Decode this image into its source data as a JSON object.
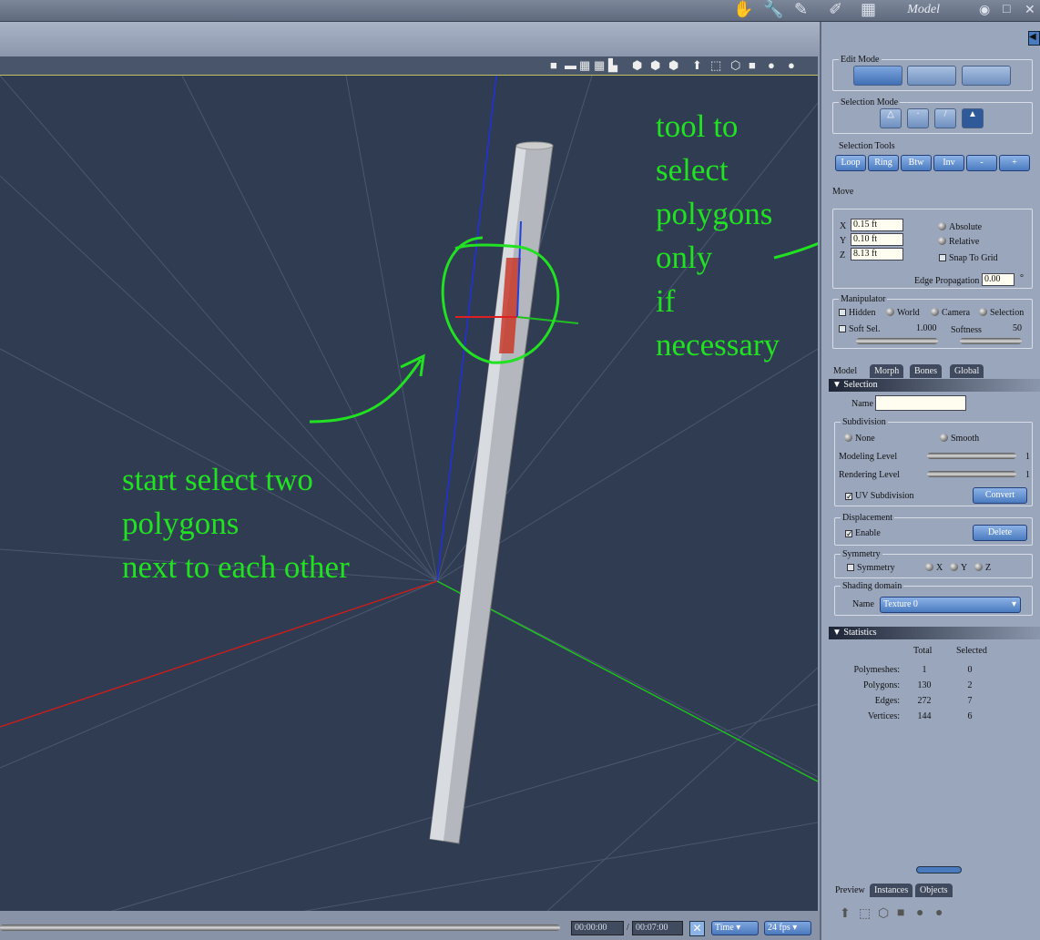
{
  "window": {
    "title": "Model"
  },
  "viewport": {
    "toolbar_icons": [
      "layout-single-icon",
      "layout-split-icon",
      "layout-quad-icon",
      "render-icon",
      "shading-icon"
    ]
  },
  "annotations": {
    "polygon_tool": "tool to\nselect\npolygons\nonly\nif\nnecessary",
    "start": "start select two\npolygons\nnext to each other",
    "color": "#22e022"
  },
  "panel": {
    "edit_mode": {
      "label": "Edit Mode"
    },
    "selection_mode": {
      "label": "Selection Mode"
    },
    "selection_tools": {
      "label": "Selection Tools",
      "buttons": [
        "Loop",
        "Ring",
        "Btw",
        "Inv",
        "-",
        "+"
      ]
    },
    "move": {
      "label": "Move",
      "x_label": "X",
      "x": "0.15 ft",
      "y_label": "Y",
      "y": "0.10 ft",
      "z_label": "Z",
      "z": "8.13 ft",
      "absolute": "Absolute",
      "relative": "Relative",
      "snap": "Snap To Grid",
      "edge_prop_label": "Edge Propagation",
      "edge_prop": "0.00",
      "degree": "°"
    },
    "manipulator": {
      "label": "Manipulator",
      "hidden": "Hidden",
      "world": "World",
      "camera": "Camera",
      "selection": "Selection",
      "soft_sel": "Soft Sel.",
      "soft_sel_value": "1.000",
      "softness": "Softness",
      "softness_value": "50"
    },
    "tabs": [
      "Model",
      "Morph",
      "Bones",
      "Global"
    ],
    "selection_section": {
      "title": "Selection",
      "name_label": "Name",
      "name_value": ""
    },
    "subdivision": {
      "label": "Subdivision",
      "none": "None",
      "smooth": "Smooth",
      "modeling_level": "Modeling Level",
      "modeling_value": "1",
      "rendering_level": "Rendering Level",
      "rendering_value": "1",
      "uv": "UV Subdivision",
      "convert": "Convert"
    },
    "displacement": {
      "label": "Displacement",
      "enable": "Enable",
      "delete": "Delete"
    },
    "symmetry": {
      "label": "Symmetry",
      "symmetry": "Symmetry",
      "x": "X",
      "y": "Y",
      "z": "Z"
    },
    "shading": {
      "label": "Shading domain",
      "name_label": "Name",
      "value": "Texture 0"
    },
    "statistics": {
      "title": "Statistics",
      "col_total": "Total",
      "col_selected": "Selected",
      "rows": [
        {
          "label": "Polymeshes:",
          "total": "1",
          "selected": "0"
        },
        {
          "label": "Polygons:",
          "total": "130",
          "selected": "2"
        },
        {
          "label": "Edges:",
          "total": "272",
          "selected": "7"
        },
        {
          "label": "Vertices:",
          "total": "144",
          "selected": "6"
        }
      ]
    },
    "bottom_tabs": [
      "Preview",
      "Instances",
      "Objects"
    ]
  },
  "timeline": {
    "current": "00:00:00",
    "sep": "/",
    "end": "00:07:00",
    "mode": "Time",
    "fps": "24 fps"
  }
}
